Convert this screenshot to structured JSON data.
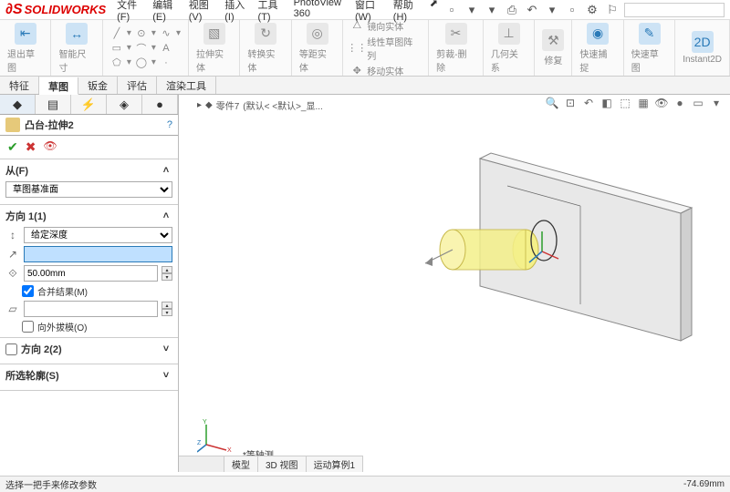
{
  "app": {
    "brand": "SOLIDWORKS"
  },
  "menus": {
    "file": "文件(F)",
    "edit": "编辑(E)",
    "view": "视图(V)",
    "insert": "插入(I)",
    "tools": "工具(T)",
    "pv360": "PhotoView 360",
    "window": "窗口(W)",
    "help": "帮助(H)"
  },
  "ribbon": {
    "exit_sketch": "退出草图",
    "smart_dim": "智能尺寸",
    "boss_extrude": "拉伸实体",
    "revolve": "转换实体",
    "offset": "等距实体",
    "mirror": "镜向实体",
    "linear_pattern": "线性草图阵列",
    "move": "移动实体",
    "trim": "剪裁-删除",
    "relations": "几何关系",
    "repair": "修复",
    "rapid": "快速捕捉",
    "rapid_sketch": "快速草图",
    "instant2d": "Instant2D"
  },
  "feature_tabs": {
    "feature": "特征",
    "sketch": "草图",
    "sheet": "钣金",
    "evaluate": "评估",
    "render": "渲染工具"
  },
  "pm": {
    "title": "凸台-拉伸2",
    "from_label": "从(F)",
    "from_value": "草图基准面",
    "dir1_label": "方向 1(1)",
    "end_condition": "给定深度",
    "depth_value": "",
    "depth_mm": "50.00mm",
    "merge": "合并结果(M)",
    "outward": "向外拔模(O)",
    "dir2_label": "方向 2(2)",
    "contours": "所选轮廓(S)"
  },
  "breadcrumb": {
    "part": "零件7",
    "config": "(默认< <默认>_显..."
  },
  "bottom_tabs": {
    "model": "模型",
    "view3d": "3D 视图",
    "motion": "运动算例1"
  },
  "view_label": "*等轴测",
  "status": {
    "prompt": "选择一把手来修改参数",
    "coord": "-74.69mm"
  }
}
